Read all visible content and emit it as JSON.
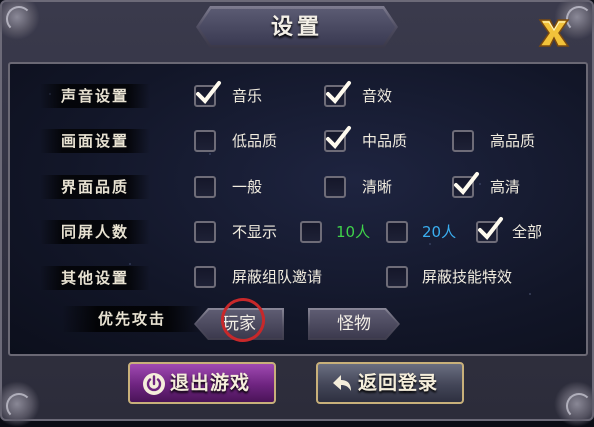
{
  "title": "设置",
  "rows": [
    {
      "label": "声音设置",
      "options": [
        {
          "label": "音乐",
          "checked": true
        },
        {
          "label": "音效",
          "checked": true
        }
      ]
    },
    {
      "label": "画面设置",
      "options": [
        {
          "label": "低品质",
          "checked": false
        },
        {
          "label": "中品质",
          "checked": true
        },
        {
          "label": "高品质",
          "checked": false
        }
      ]
    },
    {
      "label": "界面品质",
      "options": [
        {
          "label": "一般",
          "checked": false
        },
        {
          "label": "清晰",
          "checked": false
        },
        {
          "label": "高清",
          "checked": true
        }
      ]
    },
    {
      "label": "同屏人数",
      "options": [
        {
          "label": "不显示",
          "checked": false
        },
        {
          "label": "10人",
          "checked": false,
          "color": "#3fd24a"
        },
        {
          "label": "20人",
          "checked": false,
          "color": "#3aaef0"
        },
        {
          "label": "全部",
          "checked": true
        }
      ]
    },
    {
      "label": "其他设置",
      "options": [
        {
          "label": "屏蔽组队邀请",
          "checked": false
        },
        {
          "label": "屏蔽技能特效",
          "checked": false
        }
      ]
    }
  ],
  "priority": {
    "label": "优先攻击",
    "player": "玩家",
    "monster": "怪物",
    "selected": "玩家"
  },
  "buttons": {
    "exit": "退出游戏",
    "back": "返回登录"
  },
  "colors": {
    "accent_green": "#3fd24a",
    "accent_blue": "#3aaef0",
    "highlight_ring": "#c8282a",
    "exit_button": "#7a2a90"
  }
}
